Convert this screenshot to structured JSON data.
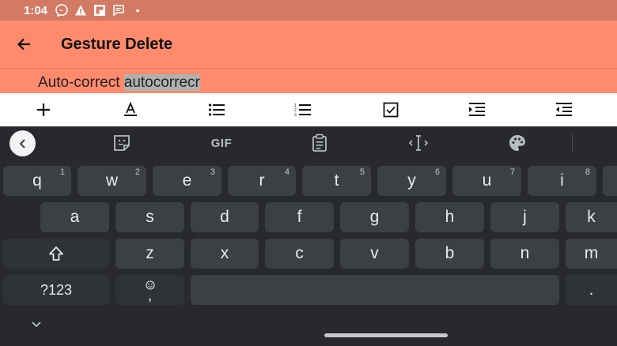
{
  "status_bar": {
    "time": "1:04",
    "icons": [
      "messenger-icon",
      "warning-icon",
      "flipboard-icon",
      "chat-icon",
      "dot-icon"
    ],
    "dot": "•"
  },
  "app_bar": {
    "title": "Gesture Delete",
    "back_icon": "arrow-back-icon"
  },
  "editor": {
    "text_before": "Auto-correct ",
    "selected_text": "autocorrecr"
  },
  "format_toolbar": {
    "items": [
      "add-icon",
      "text-color-icon",
      "bullet-list-icon",
      "numbered-list-icon",
      "checkbox-icon",
      "indent-icon",
      "outdent-icon"
    ]
  },
  "keyboard": {
    "toolbar": {
      "items": [
        "collapse-icon",
        "sticker-icon",
        "gif-button",
        "clipboard-icon",
        "text-cursor-icon",
        "palette-icon"
      ],
      "gif_label": "GIF"
    },
    "row1": [
      {
        "label": "q",
        "hint": "1"
      },
      {
        "label": "w",
        "hint": "2"
      },
      {
        "label": "e",
        "hint": "3"
      },
      {
        "label": "r",
        "hint": "4"
      },
      {
        "label": "t",
        "hint": "5"
      },
      {
        "label": "y",
        "hint": "6"
      },
      {
        "label": "u",
        "hint": "7"
      },
      {
        "label": "i",
        "hint": "8"
      }
    ],
    "row2": [
      "a",
      "s",
      "d",
      "f",
      "g",
      "h",
      "j",
      "k"
    ],
    "row3": [
      "z",
      "x",
      "c",
      "v",
      "b",
      "n",
      "m"
    ],
    "bottom": {
      "symbols_label": "?123",
      "emoji_comma_label": ",",
      "period_label": "."
    }
  },
  "nav": {
    "chevron": "chevron-down-icon"
  }
}
